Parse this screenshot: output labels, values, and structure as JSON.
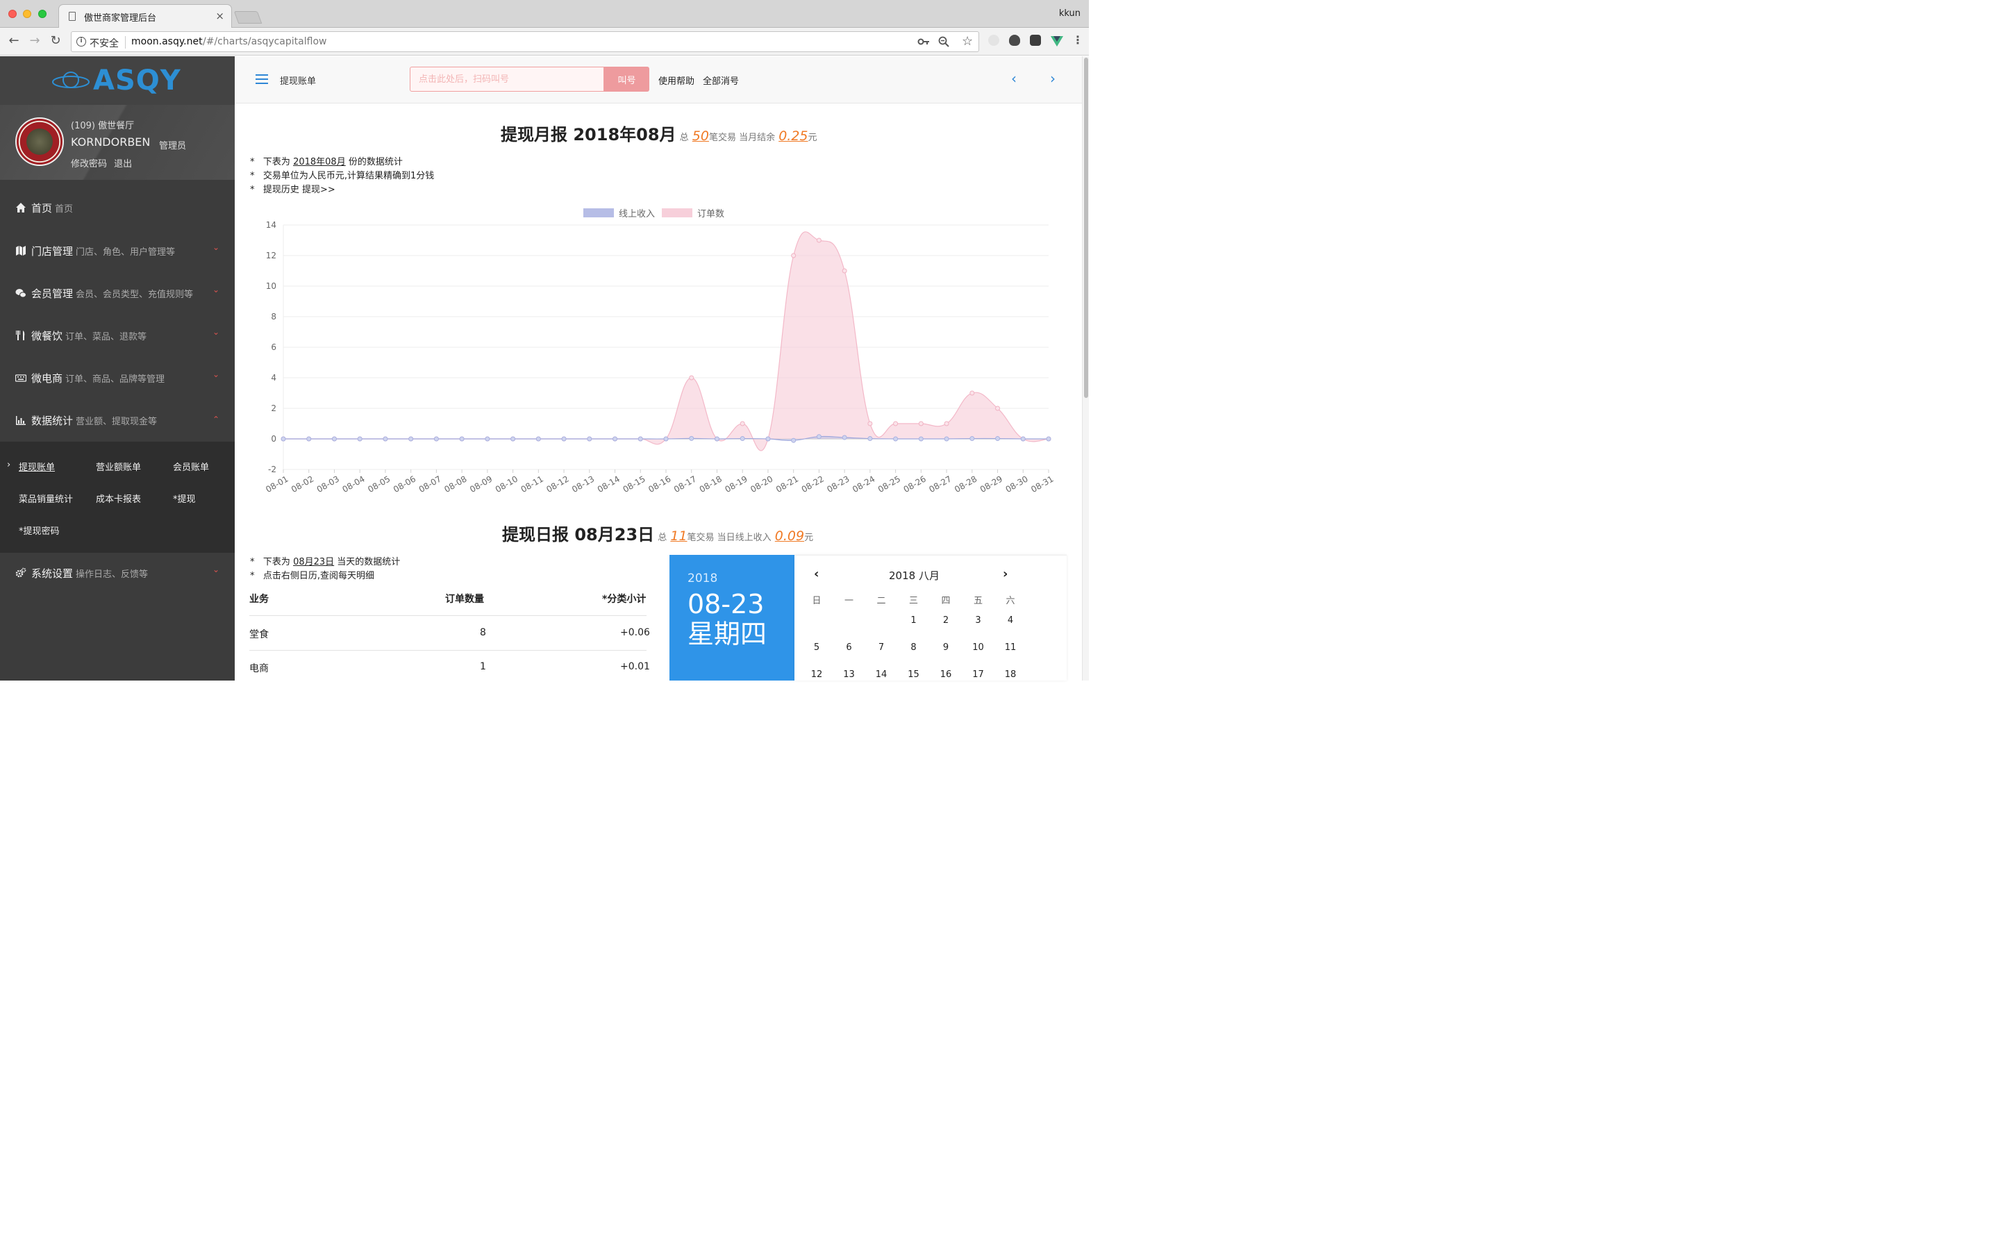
{
  "browser": {
    "tab_title": "傲世商家管理后台",
    "tab_close": "×",
    "profile_name": "kkun",
    "insecure_label": "不安全",
    "url_host": "moon.asqy.net",
    "url_path": "/#/charts/asqycapitalflow"
  },
  "sidebar": {
    "logo": "ASQY",
    "user": {
      "store": "(109) 傲世餐厅",
      "name": "KORNDORBEN",
      "role": "管理员",
      "change_password": "修改密码",
      "logout": "退出"
    },
    "menu": [
      {
        "label": "首页",
        "desc": "首页",
        "icon": "home-icon"
      },
      {
        "label": "门店管理",
        "desc": "门店、角色、用户管理等",
        "icon": "map-icon"
      },
      {
        "label": "会员管理",
        "desc": "会员、会员类型、充值规则等",
        "icon": "wechat-icon"
      },
      {
        "label": "微餐饮",
        "desc": "订单、菜品、退款等",
        "icon": "cutlery-icon"
      },
      {
        "label": "微电商",
        "desc": "订单、商品、品牌等管理",
        "icon": "keyboard-icon"
      },
      {
        "label": "数据统计",
        "desc": "营业额、提取现金等",
        "icon": "bar-chart-icon"
      },
      {
        "label": "系统设置",
        "desc": "操作日志、反馈等",
        "icon": "cogs-icon"
      }
    ],
    "submenu": [
      "提现账单",
      "营业额账单",
      "会员账单",
      "菜品销量统计",
      "成本卡报表",
      "*提现",
      "*提现密码"
    ],
    "submenu_marker": "›"
  },
  "topbar": {
    "page_name": "提现账单",
    "call_placeholder": "点击此处后，扫码叫号",
    "call_button": "叫号",
    "help": "使用帮助",
    "clear_all": "全部消号"
  },
  "monthly": {
    "title": "提现月报 2018年08月",
    "total_prefix": "总",
    "count": "50",
    "count_suffix": "笔交易 当月结余",
    "balance": "0.25",
    "unit": "元",
    "notes": {
      "n1_pre": "下表为",
      "n1_link": "2018年08月",
      "n1_post": "份的数据统计",
      "n2": "交易单位为人民币元,计算结果精确到1分钱",
      "n3": "提现历史 提现>>"
    },
    "bullet": "*"
  },
  "chart_data": {
    "type": "area",
    "legend": [
      "线上收入",
      "订单数"
    ],
    "legend_position": "top-center",
    "categories": [
      "08-01",
      "08-02",
      "08-03",
      "08-04",
      "08-05",
      "08-06",
      "08-07",
      "08-08",
      "08-09",
      "08-10",
      "08-11",
      "08-12",
      "08-13",
      "08-14",
      "08-15",
      "08-16",
      "08-17",
      "08-18",
      "08-19",
      "08-20",
      "08-21",
      "08-22",
      "08-23",
      "08-24",
      "08-25",
      "08-26",
      "08-27",
      "08-28",
      "08-29",
      "08-30",
      "08-31"
    ],
    "series": [
      {
        "name": "线上收入",
        "color": "#b6bde6",
        "values": [
          0,
          0,
          0,
          0,
          0,
          0,
          0,
          0,
          0,
          0,
          0,
          0,
          0,
          0,
          0,
          0,
          0.03,
          0,
          0.02,
          0,
          -0.1,
          0.15,
          0.09,
          0.02,
          0,
          0,
          0,
          0.02,
          0.02,
          0,
          0
        ]
      },
      {
        "name": "订单数",
        "color": "#f7cfda",
        "values": [
          0,
          0,
          0,
          0,
          0,
          0,
          0,
          0,
          0,
          0,
          0,
          0,
          0,
          0,
          0,
          0,
          4,
          0,
          1,
          0,
          12,
          13,
          11,
          1,
          1,
          1,
          1,
          3,
          2,
          0,
          0
        ]
      }
    ],
    "ylim": [
      -2,
      14
    ],
    "yticks": [
      -2,
      0,
      2,
      4,
      6,
      8,
      10,
      12,
      14
    ],
    "grid": true
  },
  "daily": {
    "title": "提现日报 08月23日",
    "total_prefix": "总",
    "count": "11",
    "count_suffix": "笔交易 当日线上收入",
    "income": "0.09",
    "unit": "元",
    "notes": {
      "n1_pre": "下表为",
      "n1_link": "08月23日",
      "n1_post": "当天的数据统计",
      "n2": "点击右侧日历,查阅每天明细"
    },
    "table": {
      "headers": [
        "业务",
        "订单数量",
        "*分类小计"
      ],
      "rows": [
        {
          "type": "堂食",
          "count": "8",
          "subtotal": "+0.06"
        },
        {
          "type": "电商",
          "count": "1",
          "subtotal": "+0.01"
        }
      ]
    }
  },
  "calendar": {
    "year": "2018",
    "date": "08-23",
    "weekday": "星期四",
    "month_label": "2018 八月",
    "dow": [
      "日",
      "一",
      "二",
      "三",
      "四",
      "五",
      "六"
    ],
    "week1": [
      "1",
      "2",
      "3",
      "4"
    ],
    "week2": [
      "5",
      "6",
      "7",
      "8",
      "9",
      "10",
      "11"
    ],
    "week3": [
      "12",
      "13",
      "14",
      "15",
      "16",
      "17",
      "18"
    ]
  },
  "colors": {
    "accent": "#2f87d6",
    "highlight": "#f07a25",
    "sidebar_bg": "#3c3c3c",
    "calendar_bg": "#2f94e8",
    "call_button": "#ee9b9e"
  }
}
